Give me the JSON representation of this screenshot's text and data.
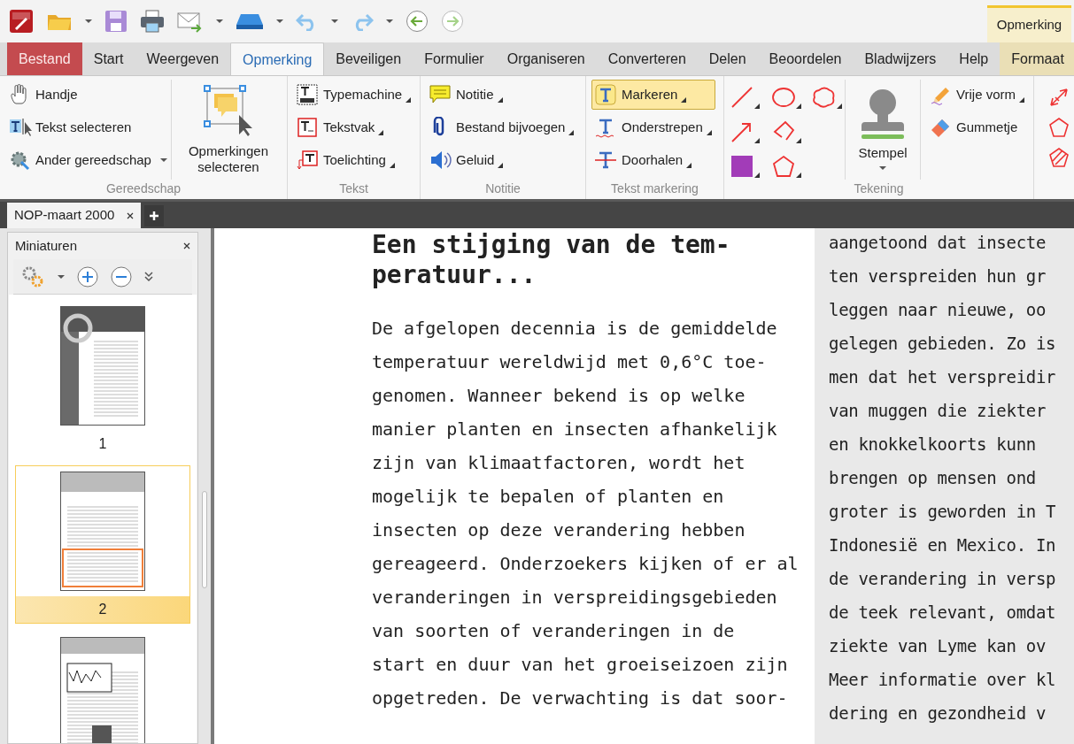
{
  "context_tab_group": {
    "label": "Opmerking"
  },
  "ribbon_tabs": [
    {
      "label": "Bestand",
      "kind": "file",
      "selected": false
    },
    {
      "label": "Start",
      "kind": "normal",
      "selected": false
    },
    {
      "label": "Weergeven",
      "kind": "normal",
      "selected": false
    },
    {
      "label": "Opmerking",
      "kind": "normal",
      "selected": true
    },
    {
      "label": "Beveiligen",
      "kind": "normal",
      "selected": false
    },
    {
      "label": "Formulier",
      "kind": "normal",
      "selected": false
    },
    {
      "label": "Organiseren",
      "kind": "normal",
      "selected": false
    },
    {
      "label": "Converteren",
      "kind": "normal",
      "selected": false
    },
    {
      "label": "Delen",
      "kind": "normal",
      "selected": false
    },
    {
      "label": "Beoordelen",
      "kind": "normal",
      "selected": false
    },
    {
      "label": "Bladwijzers",
      "kind": "normal",
      "selected": false
    },
    {
      "label": "Help",
      "kind": "normal",
      "selected": false
    },
    {
      "label": "Formaat",
      "kind": "context",
      "selected": false
    }
  ],
  "ribbon_groups": [
    {
      "label": "Gereedschap",
      "items": [
        {
          "label": "Handje",
          "dropdown": false,
          "selected": false
        },
        {
          "label": "Tekst selecteren",
          "dropdown": false,
          "selected": false
        },
        {
          "label": "Ander gereedschap",
          "dropdown": true,
          "selected": false
        }
      ],
      "large_button": {
        "label": "Opmerkingen selecteren"
      }
    },
    {
      "label": "Tekst",
      "items": [
        {
          "label": "Typemachine",
          "dropdown": true,
          "selected": false
        },
        {
          "label": "Tekstvak",
          "dropdown": true,
          "selected": false
        },
        {
          "label": "Toelichting",
          "dropdown": true,
          "selected": false
        }
      ]
    },
    {
      "label": "Notitie",
      "items": [
        {
          "label": "Notitie",
          "dropdown": true,
          "selected": false
        },
        {
          "label": "Bestand bijvoegen",
          "dropdown": true,
          "selected": false
        },
        {
          "label": "Geluid",
          "dropdown": true,
          "selected": false
        }
      ]
    },
    {
      "label": "Tekst markering",
      "items": [
        {
          "label": "Markeren",
          "dropdown": true,
          "selected": true
        },
        {
          "label": "Onderstrepen",
          "dropdown": true,
          "selected": false
        },
        {
          "label": "Doorhalen",
          "dropdown": true,
          "selected": false
        }
      ]
    },
    {
      "label": "Tekening",
      "items": [
        {
          "label": "Vrije vorm",
          "dropdown": true,
          "selected": false
        },
        {
          "label": "Gummetje",
          "dropdown": false,
          "selected": false
        }
      ],
      "large_button": {
        "label": "Stempel"
      }
    }
  ],
  "document_tabs": [
    {
      "label": "NOP-maart 2000",
      "selected": true
    }
  ],
  "thumbnail_panel": {
    "title": "Miniaturen",
    "pages": [
      {
        "label": "1",
        "selected": false
      },
      {
        "label": "2",
        "selected": true
      },
      {
        "selected": false
      }
    ]
  },
  "document": {
    "heading_lines": [
      "Een stijging van de tem-",
      "peratuur..."
    ],
    "paragraph_lines": [
      "De afgelopen decennia is de gemiddelde",
      "temperatuur wereldwijd met 0,6°C toe-",
      "genomen. Wanneer bekend is op welke",
      "manier planten en insecten afhankelijk",
      "zijn van klimaatfactoren, wordt het",
      "mogelijk te bepalen of planten en",
      "insecten op deze verandering hebben",
      "gereageerd. Onderzoekers kijken of er al",
      "veranderingen in verspreidingsgebieden",
      "van soorten of veranderingen in de",
      "start en duur van het groeiseizoen zijn",
      "opgetreden. De verwachting is dat soor-"
    ],
    "side_column_lines": [
      "aangetoond dat insecte",
      "ten verspreiden hun gr",
      "leggen naar nieuwe, oo",
      "gelegen gebieden. Zo is",
      "men dat het verspreidir",
      "van muggen die ziekter",
      "en knokkelkoorts kunn",
      "brengen op mensen ond",
      "groter is geworden in T",
      "Indonesië en Mexico. In",
      "de verandering in versp",
      "de teek relevant, omdat",
      "ziekte van Lyme kan ov",
      "Meer informatie over kl",
      "dering en gezondheid v"
    ]
  }
}
